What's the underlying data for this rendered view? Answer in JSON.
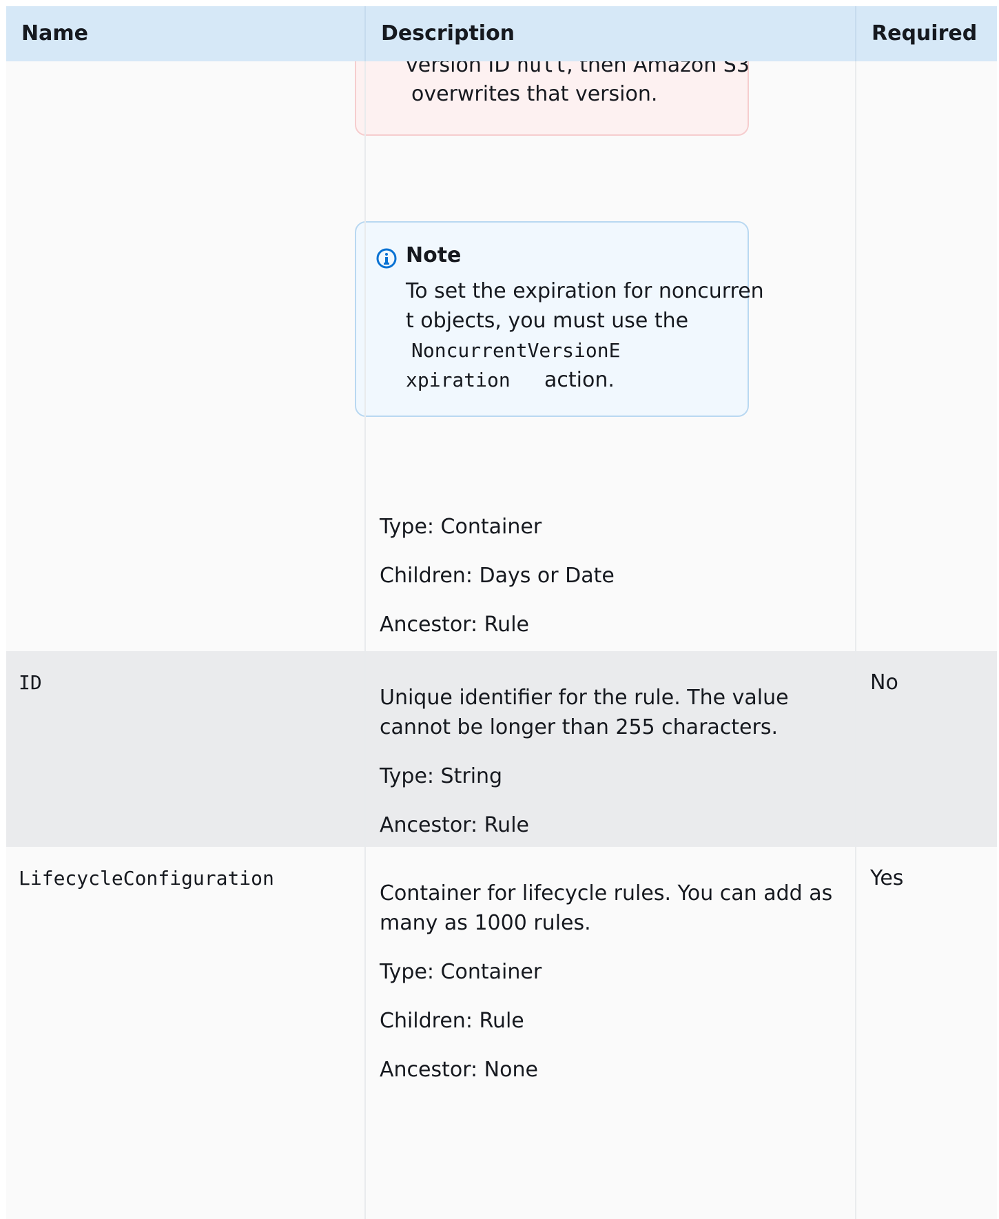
{
  "header": {
    "name": "Name",
    "description": "Description",
    "required": "Required"
  },
  "rows": [
    {
      "warning_tail": {
        "line1_pre": "version ID ",
        "line1_code": "null",
        "line1_post": ", then Amazon S3",
        "line2": "overwrites that version."
      },
      "note": {
        "title": "Note",
        "line1": "To set the expiration for noncurren",
        "line2": "t objects, you must use the",
        "code1": "NoncurrentVersionE",
        "code2": "xpiration",
        "tail": "action."
      },
      "type": "Type: Container",
      "children": "Children: Days or Date",
      "ancestor": "Ancestor: Rule"
    },
    {
      "name": "ID",
      "desc_line1": "Unique identifier for the rule. The value",
      "desc_line2": "cannot be longer than 255  characters.",
      "type": "Type: String",
      "ancestor": "Ancestor: Rule",
      "required": "No"
    },
    {
      "name": "LifecycleConfiguration",
      "desc_line1": "Container for lifecycle rules. You can add as",
      "desc_line2": "many as 1000 rules.",
      "type": "Type: Container",
      "children": "Children: Rule",
      "ancestor": "Ancestor: None",
      "required": "Yes"
    }
  ],
  "colors": {
    "header_bg": "#d6e8f7",
    "row_light": "#fafafa",
    "row_grey": "#eaebed",
    "warning_bg": "#fdf1f1",
    "note_bg": "#f1f8fe",
    "info_icon": "#0972d3"
  },
  "icons": [
    "info-icon"
  ]
}
